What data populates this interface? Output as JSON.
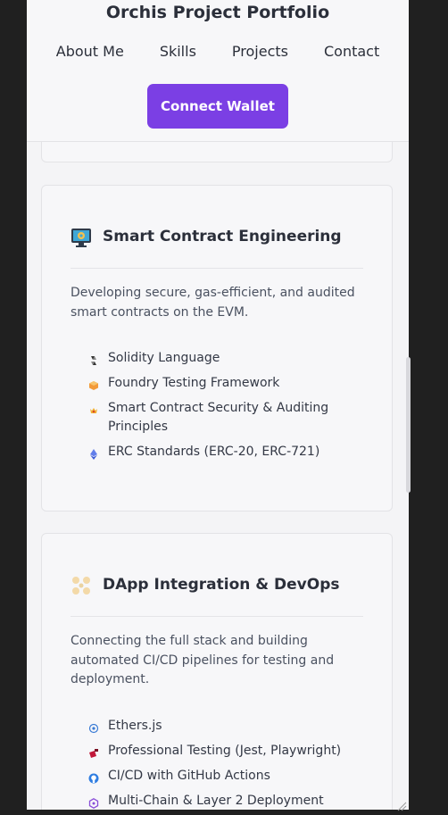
{
  "header": {
    "title": "Orchis Project Portfolio",
    "nav": [
      "About Me",
      "Skills",
      "Projects",
      "Contact"
    ],
    "connect_label": "Connect Wallet"
  },
  "cards": {
    "smart_contract": {
      "icon": "monitor-gear-icon",
      "title": "Smart Contract Engineering",
      "description": "Developing secure, gas-efficient, and audited smart contracts on the EVM.",
      "skills": [
        {
          "label": "Solidity Language",
          "icon": "solidity-icon"
        },
        {
          "label": "Foundry Testing Framework",
          "icon": "foundry-icon"
        },
        {
          "label": "Smart Contract Security & Auditing Principles",
          "icon": "shield-crown-icon"
        },
        {
          "label": "ERC Standards (ERC-20, ERC-721)",
          "icon": "ethereum-icon"
        }
      ]
    },
    "dapp": {
      "icon": "nodes-icon",
      "title": "DApp Integration & DevOps",
      "description": "Connecting the full stack and building automated CI/CD pipelines for testing and deployment.",
      "skills": [
        {
          "label": "Ethers.js",
          "icon": "ethers-icon"
        },
        {
          "label": "Professional Testing (Jest, Playwright)",
          "icon": "jest-icon"
        },
        {
          "label": "CI/CD with GitHub Actions",
          "icon": "github-icon"
        },
        {
          "label": "Multi-Chain & Layer 2 Deployment",
          "icon": "hexagon-chain-icon"
        }
      ]
    }
  },
  "colors": {
    "accent": "#7b3fe4",
    "page_bg": "#f4f4f6",
    "text": "#2b2f3a"
  }
}
